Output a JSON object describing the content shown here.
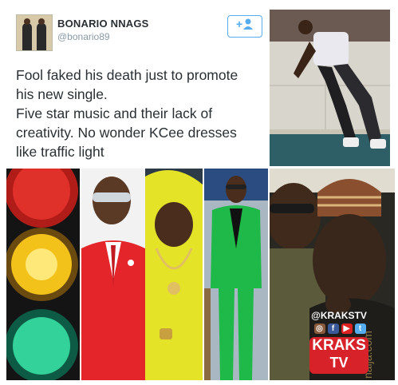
{
  "tweet": {
    "display_name": "BONARIO NNAGS",
    "handle": "@bonario89",
    "follow_label": "+👤",
    "lines": [
      "Fool faked his death just to promote",
      "his new single.",
      "Five star music and their lack of",
      "creativity. No wonder KCee dresses",
      "like traffic light"
    ]
  },
  "overlay": {
    "krakstv_handle": "@KRAKSTV",
    "logo_line1": "KRAKS",
    "logo_line2": "TV",
    "social_icons": [
      "instagram-icon",
      "facebook-icon",
      "youtube-icon",
      "twitter-icon"
    ],
    "watermark": "naija.com"
  },
  "colors": {
    "twitter_blue": "#55acee",
    "kraks_red": "#d7222a",
    "traffic_red": "#e0302a",
    "traffic_yellow": "#f2c21a",
    "traffic_green": "#33d29a"
  }
}
